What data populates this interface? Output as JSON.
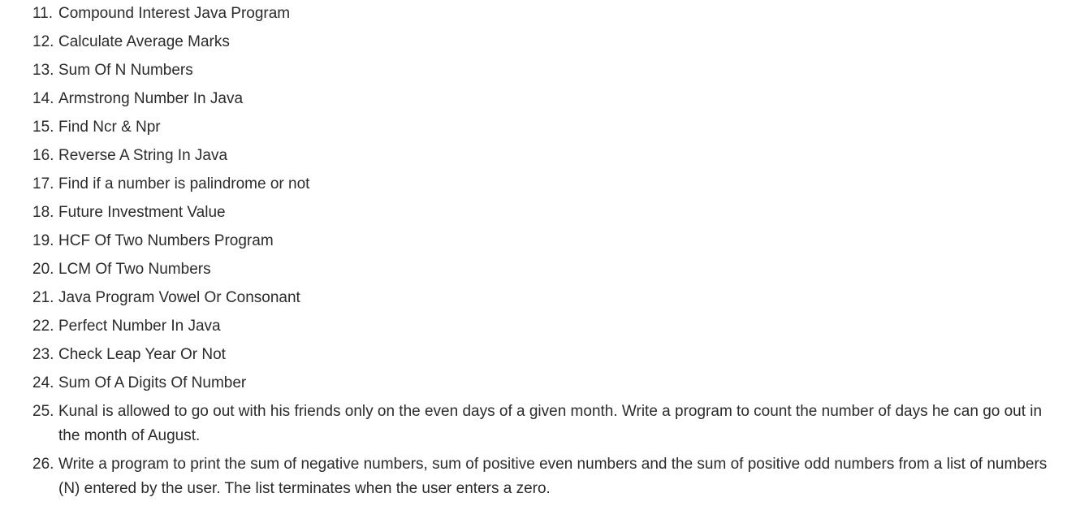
{
  "list": {
    "items": [
      {
        "number": "11.",
        "text": "Compound Interest Java Program"
      },
      {
        "number": "12.",
        "text": "Calculate Average Marks"
      },
      {
        "number": "13.",
        "text": "Sum Of N Numbers"
      },
      {
        "number": "14.",
        "text": "Armstrong Number In Java"
      },
      {
        "number": "15.",
        "text": "Find Ncr & Npr"
      },
      {
        "number": "16.",
        "text": "Reverse A String In Java"
      },
      {
        "number": "17.",
        "text": "Find if a number is palindrome or not"
      },
      {
        "number": "18.",
        "text": "Future Investment Value"
      },
      {
        "number": "19.",
        "text": "HCF Of Two Numbers Program"
      },
      {
        "number": "20.",
        "text": "LCM Of Two Numbers"
      },
      {
        "number": "21.",
        "text": "Java Program Vowel Or Consonant"
      },
      {
        "number": "22.",
        "text": "Perfect Number In Java"
      },
      {
        "number": "23.",
        "text": "Check Leap Year Or Not"
      },
      {
        "number": "24.",
        "text": "Sum Of A Digits Of Number"
      },
      {
        "number": "25.",
        "text": "Kunal is allowed to go out with his friends only on the even days of a given month. Write a program to count the number of days he can go out in the month of August."
      },
      {
        "number": "26.",
        "text": "Write a program to print the sum of negative numbers, sum of positive even numbers and the sum of positive odd numbers from a list of numbers (N) entered by the user. The list terminates when the user enters a zero."
      }
    ]
  }
}
